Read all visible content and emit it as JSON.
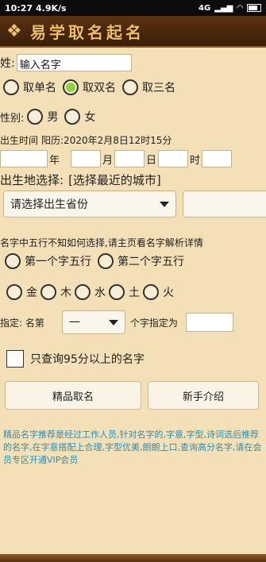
{
  "status": {
    "time": "10:27",
    "speed": "4.9K/s",
    "signal": "4G"
  },
  "header": {
    "title": "易学取名起名"
  },
  "name": {
    "label": "姓:",
    "value": "输入名字"
  },
  "name_type": {
    "options": [
      "取单名",
      "取双名",
      "取三名"
    ],
    "selected": 1
  },
  "gender": {
    "label": "性别:",
    "options": [
      "男",
      "女"
    ]
  },
  "birth": {
    "label": "出生时间",
    "value": "阳历:2020年2月8日12时15分",
    "units": [
      "年",
      "月",
      "日",
      "时"
    ]
  },
  "birthplace": {
    "label": "出生地选择:",
    "hint": "[选择最近的城市]",
    "province_placeholder": "请选择出生省份"
  },
  "wuxing": {
    "hint": "名字中五行不知如何选择,请主页看名字解析详情",
    "position_options": [
      "第一个字五行",
      "第二个字五行"
    ],
    "elements": [
      "金",
      "木",
      "水",
      "土",
      "火"
    ]
  },
  "specify": {
    "label": "指定: 名第",
    "selected": "一",
    "suffix": "个字指定为"
  },
  "filter": {
    "label": "只查询95分以上的名字"
  },
  "buttons": {
    "premium": "精品取名",
    "guide": "新手介绍"
  },
  "note": "精品名字推荐是经过工作人员,针对名字的,字意,字型,诗词选后推荐的名字,在字意搭配上合理,字型优美,朗朗上口,查询高分名字,请在会员专区开通VIP会员"
}
